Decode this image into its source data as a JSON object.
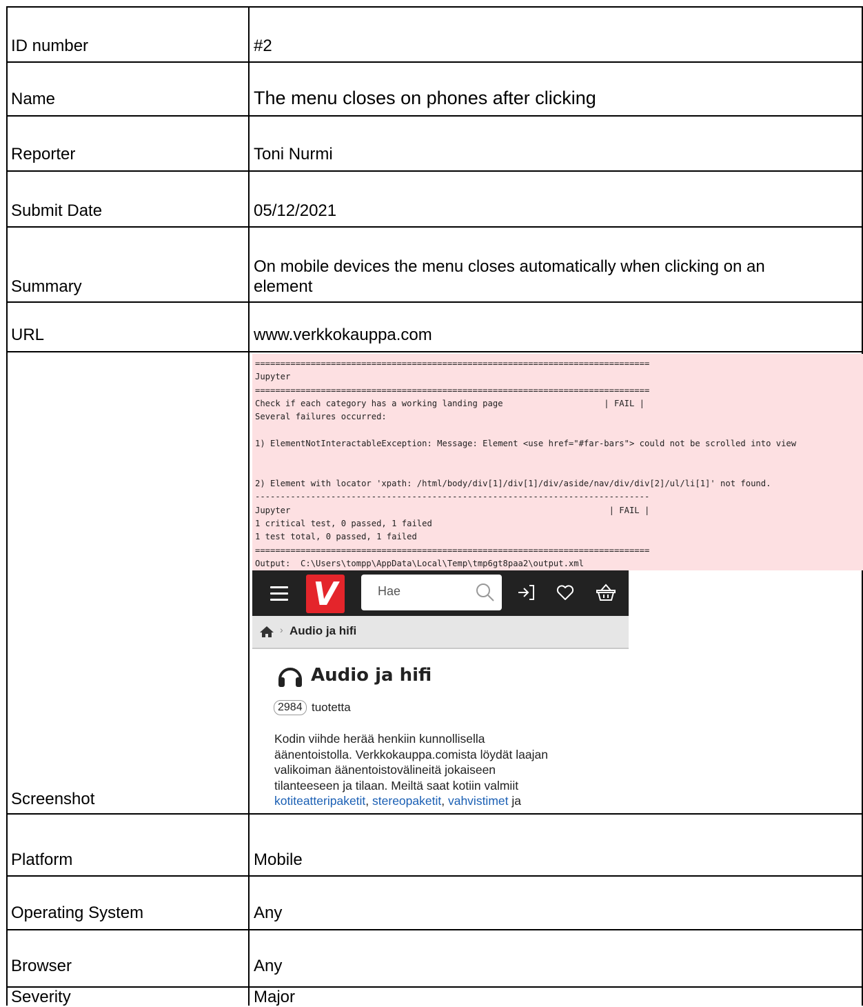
{
  "rows": [
    {
      "label": "ID number",
      "value": "#2"
    },
    {
      "label": "Name",
      "value": "The menu closes on phones after clicking"
    },
    {
      "label": "Reporter",
      "value": "Toni Nurmi"
    },
    {
      "label": "Submit Date",
      "value": "05/12/2021"
    },
    {
      "label": "Summary",
      "value_line1": "On mobile devices the menu closes automatically when clicking on an",
      "value_line2": "element"
    },
    {
      "label": "URL",
      "value": "www.verkkokauppa.com"
    },
    {
      "label": "Screenshot"
    },
    {
      "label": "Platform",
      "value": "Mobile"
    },
    {
      "label": "Operating System",
      "value": "Any"
    },
    {
      "label": "Browser",
      "value": "Any"
    },
    {
      "label": "Severity",
      "value": "Major"
    }
  ],
  "terminal": {
    "lines": [
      "==============================================================================",
      "Jupyter",
      "==============================================================================",
      "Check if each category has a working landing page                    | FAIL |",
      "Several failures occurred:",
      "",
      "1) ElementNotInteractableException: Message: Element <use href=\"#far-bars\"> could not be scrolled into view",
      "",
      "",
      "2) Element with locator 'xpath: /html/body/div[1]/div[1]/div/aside/nav/div/div[2]/ul/li[1]' not found.",
      "------------------------------------------------------------------------------",
      "Jupyter                                                               | FAIL |",
      "1 critical test, 0 passed, 1 failed",
      "1 test total, 0 passed, 1 failed",
      "==============================================================================",
      "Output:  C:\\Users\\tompp\\AppData\\Local\\Temp\\tmp6gt8paa2\\output.xml"
    ]
  },
  "mobile": {
    "logo": "V",
    "search_placeholder": "Hae",
    "breadcrumb": "Audio ja hifi",
    "category_title": "Audio ja hifi",
    "product_count": "2984",
    "product_count_label": "tuotetta",
    "desc_line1": "Kodin viihde herää henkiin kunnollisella",
    "desc_line2": "äänentoistolla. Verkkokauppa.comista löydät laajan",
    "desc_line3": "valikoiman äänentoistovälineitä jokaiseen",
    "desc_line4": "tilanteeseen ja tilaan. Meiltä saat kotiin valmiit",
    "link1": "kotiteatteripaketit",
    "sep1": ", ",
    "link2": "stereopaketit",
    "sep2": ", ",
    "link3": "vahvistimet",
    "tail": " ja",
    "icons": [
      "menu-icon",
      "search-icon",
      "login-icon",
      "heart-icon",
      "basket-icon",
      "home-icon",
      "headphones-icon"
    ],
    "colors": {
      "header": "#222222",
      "logo": "#e4252b",
      "link": "#1a5fb4",
      "terminal_bg": "#fde0e2"
    }
  }
}
